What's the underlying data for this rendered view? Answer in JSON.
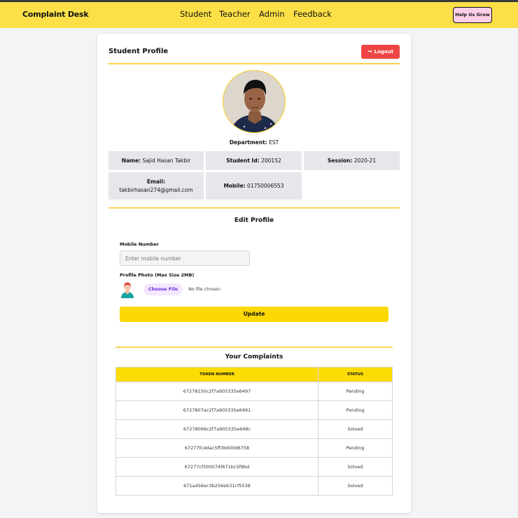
{
  "nav": {
    "brand": "Complaint Desk",
    "links": [
      "Student",
      "Teacher",
      "Admin",
      "Feedback"
    ],
    "help_button": "Help Us Grow"
  },
  "profile": {
    "title": "Student Profile",
    "logout_label": "Logout",
    "department_label": "Department:",
    "department": "EST",
    "name_label": "Name:",
    "name": "Sajid Hasan Takbir",
    "student_id_label": "Student Id:",
    "student_id": "200152",
    "session_label": "Session:",
    "session": "2020-21",
    "email_label": "Email:",
    "email": "takbirhasan274@gmail.com",
    "mobile_label": "Mobile:",
    "mobile": "01750006553"
  },
  "edit": {
    "title": "Edit Profile",
    "mobile_label": "Mobile Number",
    "mobile_placeholder": "Enter mobile number",
    "photo_label": "Profile Photo (Max Size 2MB)",
    "choose_file": "Choose File",
    "no_file": "No file chosen",
    "update_label": "Update"
  },
  "complaints": {
    "title": "Your Complaints",
    "headers": [
      "TOKEN NUMBER",
      "STATUS"
    ],
    "rows": [
      [
        "67278150c2f7a905335e6497",
        "Pending"
      ],
      [
        "6727807ac2f7a905335e6491",
        "Pending"
      ],
      [
        "67278066c2f7a905335e648c",
        "Solved"
      ],
      [
        "67277fc4dac5ff3b600d6758",
        "Pending"
      ],
      [
        "67277cf500074f671bc5f8bd",
        "Solved"
      ],
      [
        "671a456ec3b256eb31cf5538",
        "Solved"
      ]
    ]
  },
  "colors": {
    "navbar": "#fde047",
    "accent_yellow": "#fcd804",
    "logout_red": "#ef4444",
    "help_pink": "#fbcfe8"
  },
  "icons": {
    "logout": "logout-icon",
    "person": "person-icon",
    "avatar": "profile-photo"
  }
}
